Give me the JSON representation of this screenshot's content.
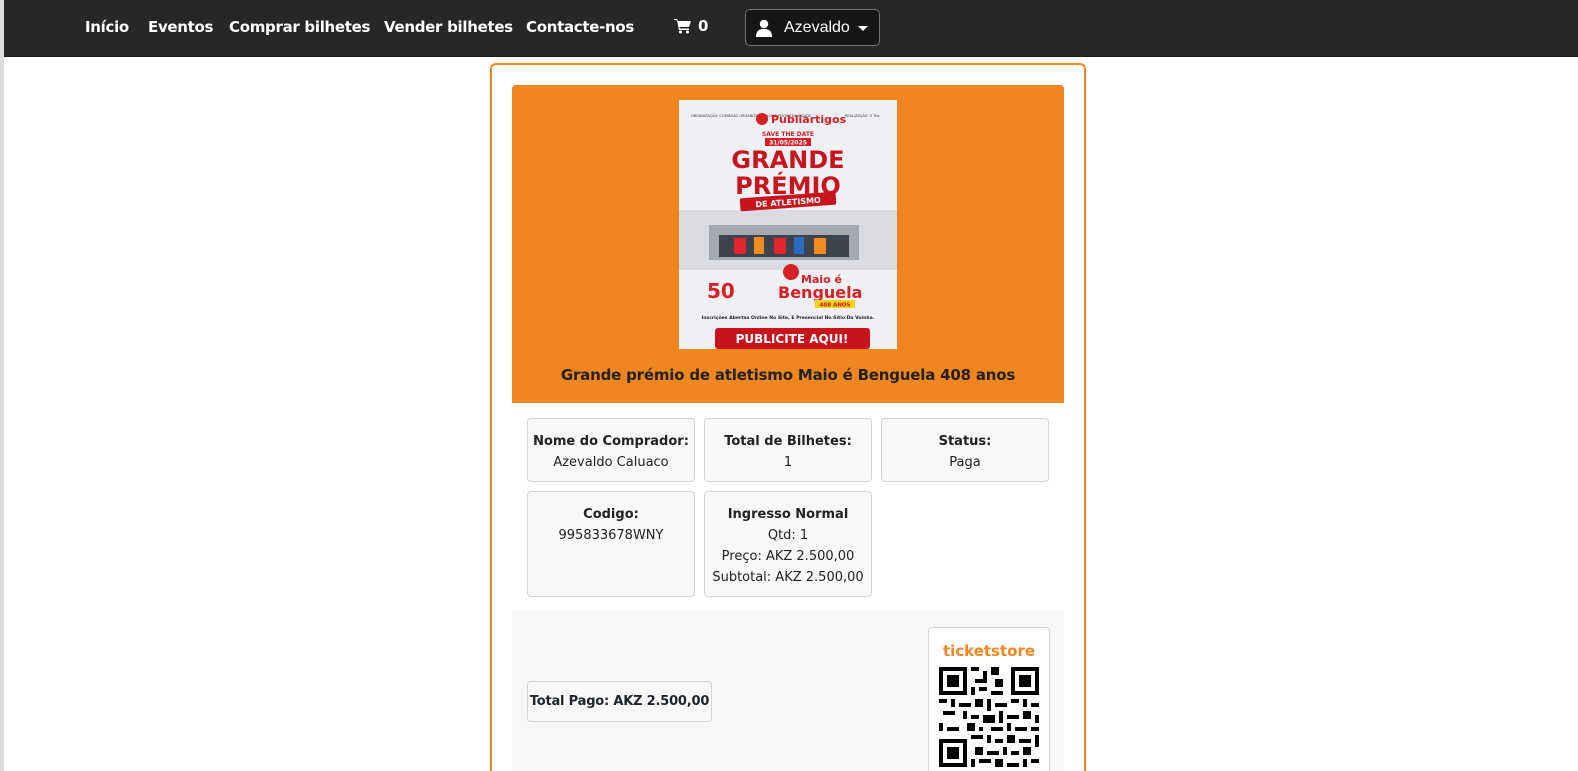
{
  "nav": {
    "items": [
      "Início",
      "Eventos",
      "Comprar bilhetes",
      "Vender bilhetes",
      "Contacte-nos"
    ],
    "cart_count": "0",
    "user_name": "Azevaldo"
  },
  "event": {
    "title": "Grande prémio de atletismo Maio é Benguela 408 anos",
    "poster": {
      "top_left": "ORGANIZAÇÃO: COMISSÃO ORGANIZADORA DAS FESTAS DA CIDADE",
      "brand": "Publiartigos",
      "top_right": "REALIZAÇÃO: O Trio",
      "save_the_date": "SAVE THE DATE",
      "date": "31/05/2025",
      "headline_1": "GRANDE",
      "headline_2": "PRÉMIO",
      "headline_3": "DE ATLETISMO",
      "logo_50": "50",
      "maio": "Maio é",
      "benguela": "Benguela",
      "years": "408 ANOS",
      "info": "Inscrições Abertas Online No Site, E Presencial No Sítio Da Voinha.",
      "cta": "PUBLICITE AQUI!"
    }
  },
  "order": {
    "buyer_label": "Nome do Comprador:",
    "buyer_value": "Azevaldo Caluaco",
    "tickets_label": "Total de Bilhetes:",
    "tickets_value": "1",
    "status_label": "Status:",
    "status_value": "Paga",
    "code_label": "Codigo:",
    "code_value": "995833678WNY",
    "ticket_type": "Ingresso Normal",
    "ticket_qty": "Qtd: 1",
    "ticket_price": "Preço: AKZ 2.500,00",
    "ticket_subtotal": "Subtotal: AKZ 2.500,00",
    "total_paid": "Total Pago: AKZ 2.500,00",
    "qr_brand": "ticketstore"
  },
  "colors": {
    "accent": "#f0861f",
    "navbar": "#272727",
    "poster_red": "#d81f26"
  }
}
